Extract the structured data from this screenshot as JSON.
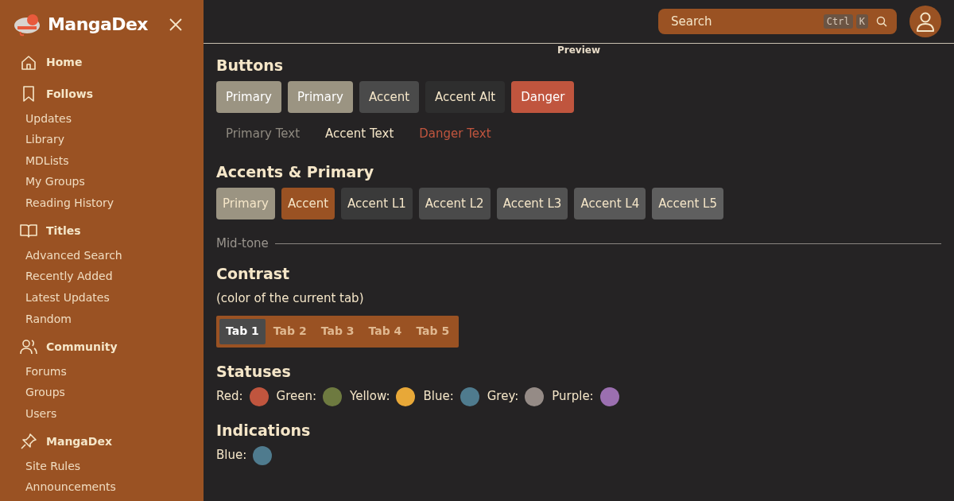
{
  "sidebar": {
    "logo": "MangaDex",
    "sections": [
      {
        "label": "Home"
      },
      {
        "label": "Follows",
        "items": [
          "Updates",
          "Library",
          "MDLists",
          "My Groups",
          "Reading History"
        ]
      },
      {
        "label": "Titles",
        "items": [
          "Advanced Search",
          "Recently Added",
          "Latest Updates",
          "Random"
        ]
      },
      {
        "label": "Community",
        "items": [
          "Forums",
          "Groups",
          "Users"
        ]
      },
      {
        "label": "MangaDex",
        "items": [
          "Site Rules",
          "Announcements"
        ]
      }
    ]
  },
  "header": {
    "search": {
      "placeholder": "Search",
      "keys": [
        "Ctrl",
        "K"
      ]
    }
  },
  "page_title": "Preview",
  "sections": [
    {
      "kind": "buttons",
      "title": "Buttons",
      "buttons": [
        {
          "label": "Primary",
          "kind": "primary"
        },
        {
          "label": "Primary",
          "kind": "primary"
        },
        {
          "label": "Accent",
          "kind": "accent"
        },
        {
          "label": "Accent Alt",
          "kind": "accentalt"
        },
        {
          "label": "Danger",
          "kind": "danger"
        }
      ],
      "text_buttons": [
        {
          "label": "Primary Text",
          "kind": "primary"
        },
        {
          "label": "Accent Text",
          "kind": "accent"
        },
        {
          "label": "Danger Text",
          "kind": "danger"
        }
      ]
    },
    {
      "kind": "swatches",
      "title": "Accents & Primary",
      "swatches": [
        {
          "label": "Primary",
          "kind": "primary"
        },
        {
          "label": "Accent",
          "kind": "accent"
        },
        {
          "label": "Accent L1",
          "kind": "l1"
        },
        {
          "label": "Accent L2",
          "kind": "l2"
        },
        {
          "label": "Accent L3",
          "kind": "l3"
        },
        {
          "label": "Accent L4",
          "kind": "l4"
        },
        {
          "label": "Accent L5",
          "kind": "l5"
        }
      ]
    },
    {
      "kind": "divider",
      "label": "Mid-tone"
    },
    {
      "kind": "tabs",
      "title": "Contrast",
      "note": "(color of the current tab)",
      "tabs": [
        {
          "label": "Tab 1",
          "selected": true
        },
        {
          "label": "Tab 2",
          "selected": false
        },
        {
          "label": "Tab 3",
          "selected": false
        },
        {
          "label": "Tab 4",
          "selected": false
        },
        {
          "label": "Tab 5",
          "selected": false
        }
      ]
    },
    {
      "kind": "dots",
      "title": "Statuses",
      "items": [
        {
          "label": "Red:",
          "color": "#c0553e"
        },
        {
          "label": "Green:",
          "color": "#6e7a40"
        },
        {
          "label": "Yellow:",
          "color": "#e8a838"
        },
        {
          "label": "Blue:",
          "color": "#4f7b8e"
        },
        {
          "label": "Grey:",
          "color": "#958b86"
        },
        {
          "label": "Purple:",
          "color": "#9b6fb0"
        }
      ]
    },
    {
      "kind": "dots",
      "title": "Indications",
      "items": [
        {
          "label": "Blue:",
          "color": "#4f7b8e"
        }
      ]
    }
  ]
}
